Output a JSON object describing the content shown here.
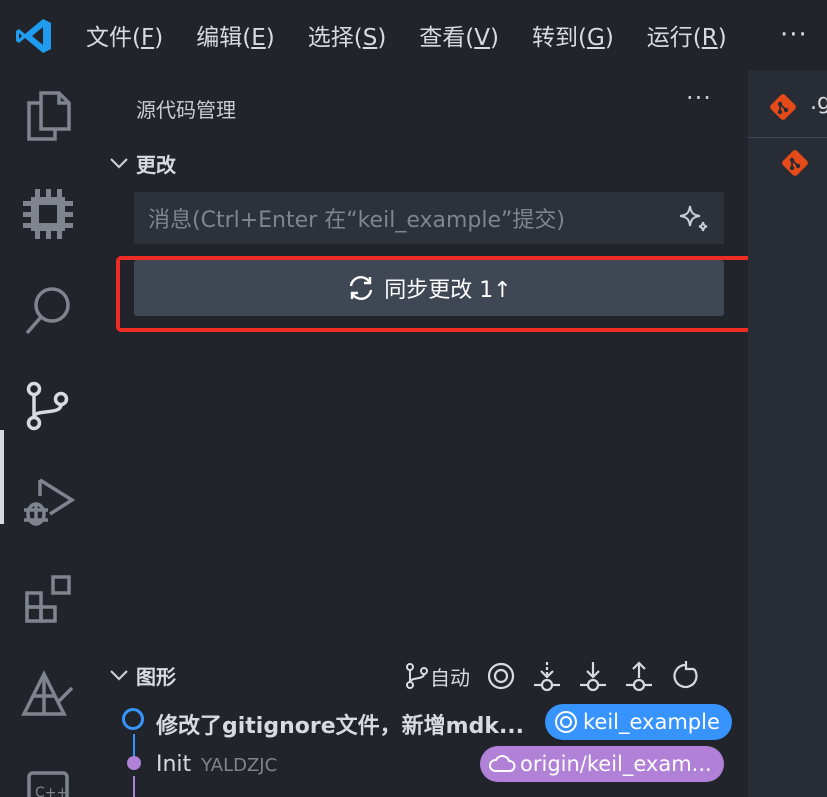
{
  "menu": {
    "items": [
      {
        "label": "文件",
        "accel": "F"
      },
      {
        "label": "编辑",
        "accel": "E"
      },
      {
        "label": "选择",
        "accel": "S"
      },
      {
        "label": "查看",
        "accel": "V"
      },
      {
        "label": "转到",
        "accel": "G"
      },
      {
        "label": "运行",
        "accel": "R"
      }
    ],
    "more_label": "···"
  },
  "activity_bar": {
    "items": [
      "explorer-icon",
      "chip-icon",
      "search-icon",
      "source-control-icon",
      "run-debug-icon",
      "extensions-icon",
      "deploy-icon",
      "cpp-icon"
    ],
    "active": "source-control-icon"
  },
  "sidebar": {
    "title": "源代码管理",
    "more_label": "···",
    "changes_section": {
      "title": "更改",
      "message_placeholder": "消息(Ctrl+Enter 在“keil_example”提交)",
      "sync_button": {
        "label": "同步更改 1↑"
      }
    },
    "graph_section": {
      "title": "图形",
      "auto_label": "自动",
      "commits": [
        {
          "message": "修改了gitignore文件，新增mdk...",
          "author": "",
          "badge": "keil_example",
          "badge_color": "#3794ff"
        },
        {
          "message": "Init",
          "author": "YALDZJC",
          "badge": "origin/keil_exam...",
          "badge_color": "#b180d7"
        }
      ]
    }
  },
  "editor": {
    "tab_label": ".g"
  },
  "colors": {
    "accent_blue": "#3794ff",
    "accent_purple": "#b180d7",
    "highlight_red": "#ee2b24",
    "git_orange": "#e64a19"
  }
}
